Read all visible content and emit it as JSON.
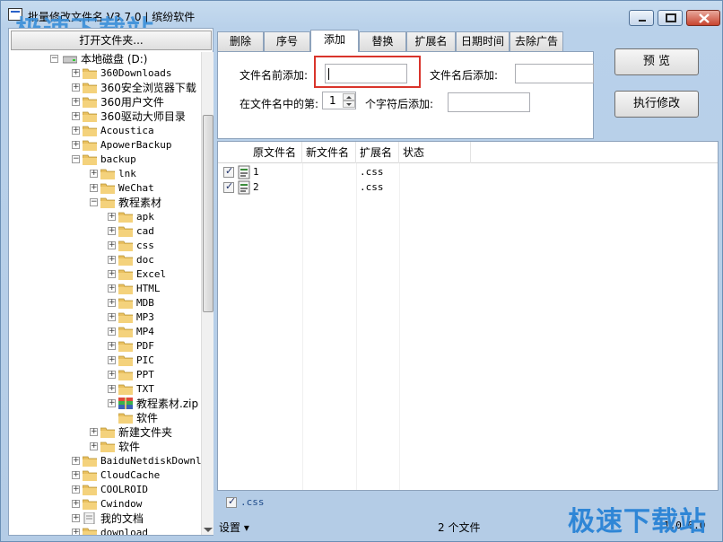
{
  "window": {
    "title": "批量修改文件名 V3.7.0 | 缤纷软件",
    "watermark_top": "极速下载站",
    "watermark_bottom": "极速下载站"
  },
  "left_panel": {
    "open_folder_label": "打开文件夹..."
  },
  "tree": [
    {
      "label": "本地磁盘 (D:)",
      "level": 0,
      "type": "drive",
      "expander": "-"
    },
    {
      "label": "360Downloads",
      "level": 1,
      "type": "folder",
      "expander": "+"
    },
    {
      "label": "360安全浏览器下载",
      "level": 1,
      "type": "folder",
      "expander": "+"
    },
    {
      "label": "360用户文件",
      "level": 1,
      "type": "folder",
      "expander": "+"
    },
    {
      "label": "360驱动大师目录",
      "level": 1,
      "type": "folder",
      "expander": "+"
    },
    {
      "label": "Acoustica",
      "level": 1,
      "type": "folder",
      "expander": "+"
    },
    {
      "label": "ApowerBackup",
      "level": 1,
      "type": "folder",
      "expander": "+"
    },
    {
      "label": "backup",
      "level": 1,
      "type": "folder",
      "expander": "-"
    },
    {
      "label": "lnk",
      "level": 2,
      "type": "folder",
      "expander": "+"
    },
    {
      "label": "WeChat",
      "level": 2,
      "type": "folder",
      "expander": "+"
    },
    {
      "label": "教程素材",
      "level": 2,
      "type": "folder",
      "expander": "-"
    },
    {
      "label": "apk",
      "level": 3,
      "type": "folder",
      "expander": "+"
    },
    {
      "label": "cad",
      "level": 3,
      "type": "folder",
      "expander": "+"
    },
    {
      "label": "css",
      "level": 3,
      "type": "folder",
      "expander": "+"
    },
    {
      "label": "doc",
      "level": 3,
      "type": "folder",
      "expander": "+"
    },
    {
      "label": "Excel",
      "level": 3,
      "type": "folder",
      "expander": "+"
    },
    {
      "label": "HTML",
      "level": 3,
      "type": "folder",
      "expander": "+"
    },
    {
      "label": "MDB",
      "level": 3,
      "type": "folder",
      "expander": "+"
    },
    {
      "label": "MP3",
      "level": 3,
      "type": "folder",
      "expander": "+"
    },
    {
      "label": "MP4",
      "level": 3,
      "type": "folder",
      "expander": "+"
    },
    {
      "label": "PDF",
      "level": 3,
      "type": "folder",
      "expander": "+"
    },
    {
      "label": "PIC",
      "level": 3,
      "type": "folder",
      "expander": "+"
    },
    {
      "label": "PPT",
      "level": 3,
      "type": "folder",
      "expander": "+"
    },
    {
      "label": "TXT",
      "level": 3,
      "type": "folder",
      "expander": "+"
    },
    {
      "label": "教程素材.zip",
      "level": 3,
      "type": "zip",
      "expander": "+"
    },
    {
      "label": "软件",
      "level": 3,
      "type": "folder",
      "expander": ""
    },
    {
      "label": "新建文件夹",
      "level": 2,
      "type": "folder",
      "expander": "+"
    },
    {
      "label": "软件",
      "level": 2,
      "type": "folder",
      "expander": "+"
    },
    {
      "label": "BaiduNetdiskDownload",
      "level": 1,
      "type": "folder",
      "expander": "+"
    },
    {
      "label": "CloudCache",
      "level": 1,
      "type": "folder",
      "expander": "+"
    },
    {
      "label": "COOLROID",
      "level": 1,
      "type": "folder",
      "expander": "+"
    },
    {
      "label": "Cwindow",
      "level": 1,
      "type": "folder",
      "expander": "+"
    },
    {
      "label": "我的文档",
      "level": 1,
      "type": "docs",
      "expander": "+"
    },
    {
      "label": "download",
      "level": 1,
      "type": "folder",
      "expander": "+"
    }
  ],
  "tabs": [
    "删除",
    "序号",
    "添加",
    "替换",
    "扩展名",
    "日期时间",
    "去除广告"
  ],
  "active_tab": "添加",
  "add_panel": {
    "prefix_label": "文件名前添加:",
    "prefix_value": "",
    "suffix_label": "文件名后添加:",
    "suffix_value": "",
    "position_label": "在文件名中的第:",
    "position_value": "1",
    "after_chars_label": "个字符后添加:",
    "after_chars_value": ""
  },
  "buttons": {
    "preview": "预  览",
    "apply": "执行修改"
  },
  "list": {
    "columns": [
      "原文件名",
      "新文件名",
      "扩展名",
      "状态"
    ],
    "rows": [
      {
        "checked": true,
        "name": "1",
        "new_name": "",
        "ext": ".css",
        "status": ""
      },
      {
        "checked": true,
        "name": "2",
        "new_name": "",
        "ext": ".css",
        "status": ""
      }
    ]
  },
  "filter": {
    "checked": true,
    "ext": ".css"
  },
  "status": {
    "settings": "设置 ▾",
    "count": "2 个文件",
    "right": "1.0.0.0"
  },
  "colors": {
    "highlight_box": "#d9342b",
    "title_bar": "#c6dbef",
    "watermark": "#3a8fd9"
  }
}
